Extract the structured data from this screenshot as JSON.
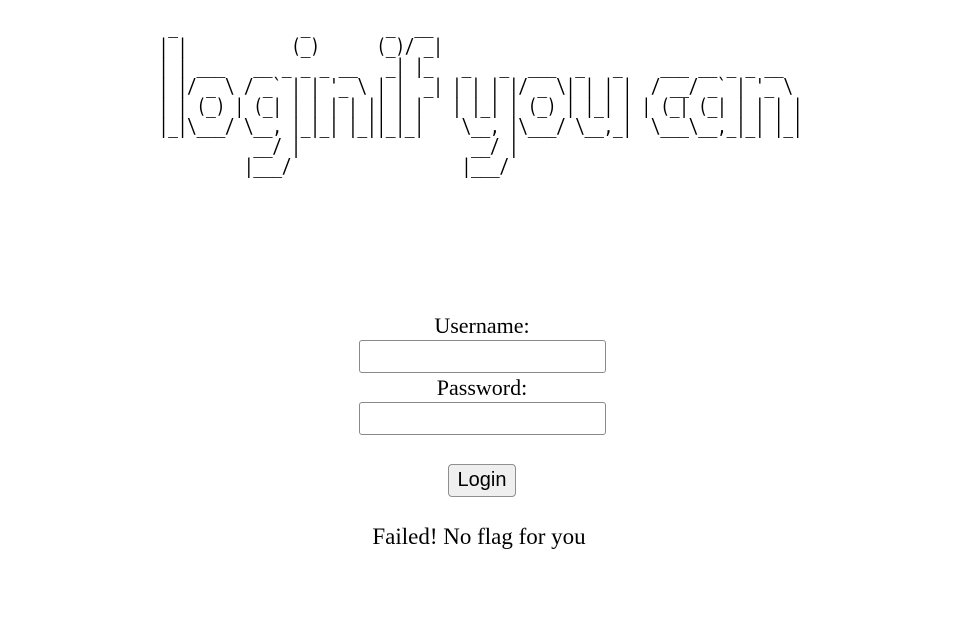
{
  "banner": {
    "ascii_art": " _             _        _  __                                   \n| |           (_)      (_)/ _|                                  \n| | ___   __ _ _ _ __   _| |_   _   _  ___  _   _    ___ __ _ _ __  \n| |/ _ \\ / _` | | '_ \\ | |  _| | | | |/ _ \\| | | |  / __/ _` | '_ \\ \n| | (_) | (_| | | | | || | |   | |_| | (_) | |_| | | (_| (_| | | | |\n|_|\\___/ \\__, |_|_| |_||_|_|    \\__, |\\___/ \\__,_|  \\___\\__,_|_| |_|\n          __/ |                  __/ |                               \n         |___/                  |___/                                "
  },
  "form": {
    "username_label": "Username:",
    "username_value": "",
    "password_label": "Password:",
    "password_value": "",
    "login_button": "Login"
  },
  "status": {
    "message": "Failed! No flag for you"
  }
}
